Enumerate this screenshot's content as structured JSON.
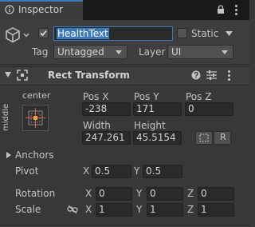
{
  "tab": {
    "title": "Inspector"
  },
  "header": {
    "name_value": "HealthText",
    "static_label": "Static",
    "tag_label": "Tag",
    "tag_value": "Untagged",
    "layer_label": "Layer",
    "layer_value": "UI"
  },
  "component": {
    "title": "Rect Transform"
  },
  "anchor_preset": {
    "horizontal": "center",
    "vertical": "middle"
  },
  "position": {
    "pos_x_label": "Pos X",
    "pos_x": "-238",
    "pos_y_label": "Pos Y",
    "pos_y": "171",
    "pos_z_label": "Pos Z",
    "pos_z": "0",
    "width_label": "Width",
    "width": "247.261",
    "height_label": "Height",
    "height": "45.5154",
    "r_button": "R"
  },
  "anchors": {
    "label": "Anchors"
  },
  "pivot": {
    "label": "Pivot",
    "x_label": "X",
    "x": "0.5",
    "y_label": "Y",
    "y": "0.5"
  },
  "rotation": {
    "label": "Rotation",
    "x_label": "X",
    "x": "0",
    "y_label": "Y",
    "y": "0",
    "z_label": "Z",
    "z": "0"
  },
  "scale": {
    "label": "Scale",
    "x_label": "X",
    "x": "1",
    "y_label": "Y",
    "y": "1",
    "z_label": "Z",
    "z": "1"
  },
  "colors": {
    "accent": "#3a79bb",
    "anchor_line": "#e06040",
    "background": "#383838"
  }
}
